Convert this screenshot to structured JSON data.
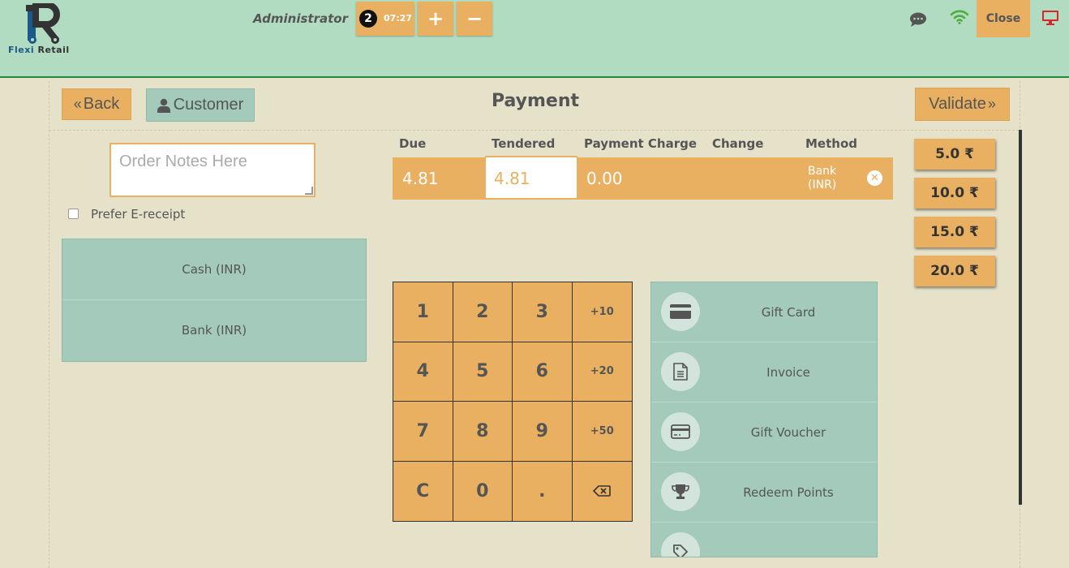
{
  "header": {
    "logo_text_1": "Flexi",
    "logo_text_2": "Retail",
    "user_name": "Administrator",
    "order_count": "2",
    "order_time": "07:27",
    "add_label": "+",
    "remove_label": "−",
    "close_label": "Close"
  },
  "toolbar": {
    "back_label": "Back",
    "customer_label": "Customer",
    "title": "Payment",
    "validate_label": "Validate"
  },
  "notes": {
    "placeholder": "Order Notes Here",
    "ereceipt_label": "Prefer E-receipt"
  },
  "payment_methods": [
    {
      "label": "Cash (INR)"
    },
    {
      "label": "Bank (INR)"
    }
  ],
  "payment_table": {
    "headers": [
      "Due",
      "Tendered",
      "Payment Charge",
      "Change",
      "Method"
    ],
    "row": {
      "due": "4.81",
      "tendered": "4.81",
      "charge": "0.00",
      "change": "",
      "method_line1": "Bank",
      "method_line2": "(INR)"
    }
  },
  "keypad": [
    "1",
    "2",
    "3",
    "+10",
    "4",
    "5",
    "6",
    "+20",
    "7",
    "8",
    "9",
    "+50",
    "C",
    "0",
    "."
  ],
  "options": [
    {
      "label": "Gift Card",
      "icon": "credit-card-icon"
    },
    {
      "label": "Invoice",
      "icon": "document-icon"
    },
    {
      "label": "Gift Voucher",
      "icon": "voucher-card-icon"
    },
    {
      "label": "Redeem Points",
      "icon": "trophy-icon"
    },
    {
      "label": "",
      "icon": "tag-icon"
    }
  ],
  "quick_amounts": [
    "5.0 ₹",
    "10.0 ₹",
    "15.0 ₹",
    "20.0 ₹"
  ],
  "colors": {
    "accent": "#e8b060",
    "teal": "#a3cabb",
    "header": "#b2dcc1",
    "background": "#e5e2c9"
  }
}
